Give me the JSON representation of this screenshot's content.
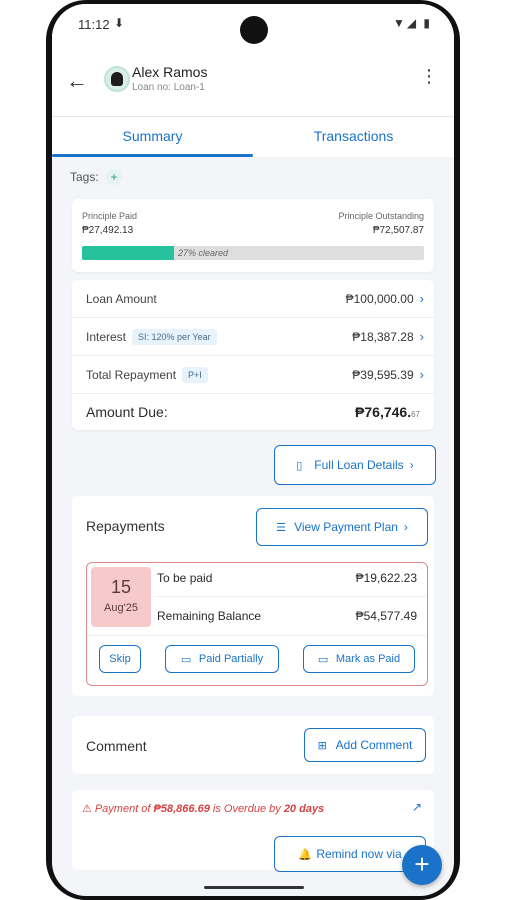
{
  "status": {
    "time": "11:12",
    "download": "⬇",
    "right": "▼◢ ▮"
  },
  "header": {
    "name": "Alex Ramos",
    "loan_no": "Loan no: Loan-1"
  },
  "tabs": [
    {
      "label": "Summary"
    },
    {
      "label": "Transactions"
    }
  ],
  "tags": {
    "label": "Tags:"
  },
  "principal": {
    "paid_label": "Principle Paid",
    "paid_value": "₱27,492.13",
    "outstanding_label": "Principle Outstanding",
    "outstanding_value": "₱72,507.87",
    "progress_percent": 27,
    "progress_text": "27% cleared"
  },
  "summary": {
    "loan_amount_label": "Loan Amount",
    "loan_amount": "₱100,000.00",
    "interest_label": "Interest",
    "interest_chip": "SI: 120% per Year",
    "interest": "₱18,387.28",
    "repayment_label": "Total Repayment",
    "repayment_chip": "P+I",
    "repayment": "₱39,595.39",
    "amount_due_label": "Amount Due:",
    "amount_due": "₱76,746.",
    "amount_due_cents": "67"
  },
  "full_loan_label": "Full Loan Details",
  "repayments": {
    "title": "Repayments",
    "view_plan_label": "View Payment Plan",
    "date_day": "15",
    "date_month": "Aug'25",
    "to_be_paid_label": "To be paid",
    "to_be_paid": "₱19,622.23",
    "remaining_label": "Remaining Balance",
    "remaining": "₱54,577.49",
    "skip_label": "Skip",
    "paid_partially_label": "Paid Partially",
    "mark_paid_label": "Mark as Paid"
  },
  "comment": {
    "title": "Comment",
    "add_label": "Add Comment"
  },
  "overdue": {
    "prefix": "Payment of ",
    "amount": "₱58,866.69",
    "middle": " is Overdue by ",
    "days": "20 days",
    "remind_label": "Remind now via"
  },
  "colors": {
    "accent": "#1a73c9",
    "progress": "#26c29b",
    "overdue": "#d34242",
    "date_bg": "#f6caca"
  }
}
